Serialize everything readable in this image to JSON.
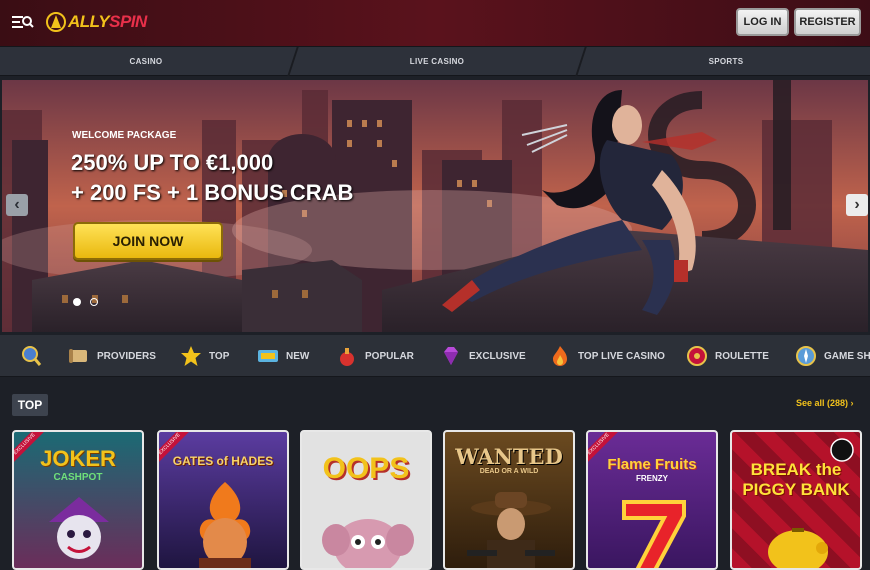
{
  "header": {
    "logo_part1": "ALLY",
    "logo_part2": "SPIN",
    "login_label": "LOG IN",
    "register_label": "REGISTER"
  },
  "nav": {
    "tabs": [
      {
        "label": "CASINO"
      },
      {
        "label": "LIVE CASINO"
      },
      {
        "label": "SPORTS"
      }
    ]
  },
  "hero": {
    "eyebrow": "WELCOME PACKAGE",
    "line1": "250% UP TO €1,000",
    "line2": "+ 200 FS + 1 BONUS CRAB",
    "cta_label": "JOIN NOW",
    "slide_count": 2,
    "active_slide": 1
  },
  "categories": {
    "items": [
      {
        "label": "PROVIDERS",
        "icon": "scroll-icon"
      },
      {
        "label": "TOP",
        "icon": "star-icon"
      },
      {
        "label": "NEW",
        "icon": "new-badge-icon"
      },
      {
        "label": "POPULAR",
        "icon": "fire-potion-icon"
      },
      {
        "label": "EXCLUSIVE",
        "icon": "gem-icon"
      },
      {
        "label": "TOP LIVE CASINO",
        "icon": "flame-icon"
      },
      {
        "label": "ROULETTE",
        "icon": "roulette-icon"
      },
      {
        "label": "GAME SHO",
        "icon": "compass-icon"
      }
    ]
  },
  "games_section": {
    "title": "TOP",
    "see_all_label": "See all (288)",
    "games": [
      {
        "name": "JOKER",
        "sub": "CASHPOT",
        "exclusive": "EXCLUSIVE",
        "bg": "#1b6a74"
      },
      {
        "name": "GATES of HADES",
        "sub": "",
        "exclusive": "EXCLUSIVE",
        "bg": "#3e2c7a"
      },
      {
        "name": "OOPS",
        "sub": "",
        "exclusive": "",
        "bg": "#d9d9d9"
      },
      {
        "name": "WANTED",
        "sub": "DEAD OR A WILD",
        "exclusive": "",
        "bg": "#4a3416"
      },
      {
        "name": "Flame Fruits",
        "sub": "FRENZY",
        "exclusive": "EXCLUSIVE",
        "bg": "#4a2270"
      },
      {
        "name": "BREAK the PIGGY BANK",
        "sub": "",
        "exclusive": "",
        "bg": "#a3122a"
      }
    ]
  }
}
